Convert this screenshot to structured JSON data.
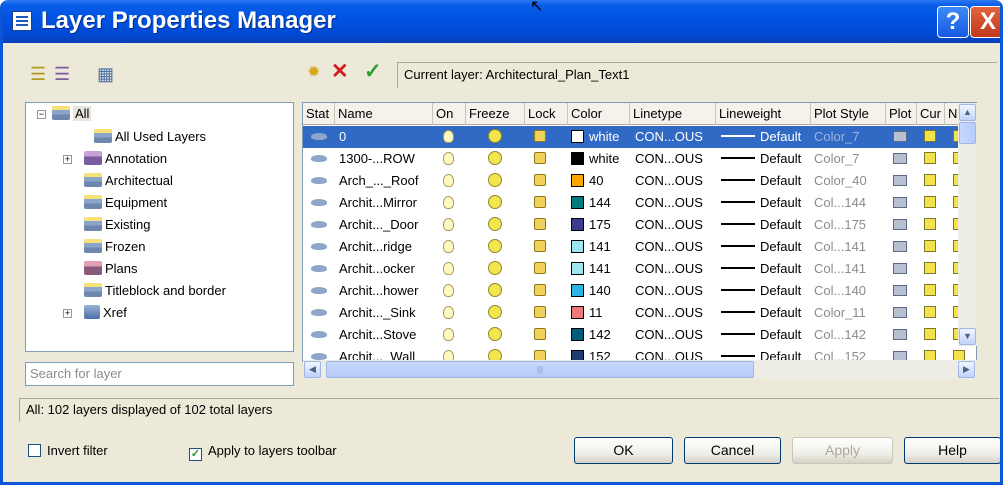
{
  "window": {
    "title": "Layer Properties Manager",
    "help_glyph": "?",
    "close_glyph": "X"
  },
  "toolbar": {
    "new_property_filter_icon": "new-property-filter-icon",
    "new_group_filter_icon": "new-group-filter-icon",
    "layer_states_icon": "layer-states-manager-icon",
    "new_layer_icon": "new-layer-icon",
    "delete_layer_icon": "delete-layer-icon",
    "set_current_icon": "set-current-icon",
    "current_layer": "Current layer: Architectural_Plan_Text1"
  },
  "tree": {
    "root": "All",
    "items": [
      {
        "label": "All Used Layers",
        "expandable": false
      },
      {
        "label": "Annotation",
        "expandable": true
      },
      {
        "label": "Architectual",
        "expandable": false
      },
      {
        "label": "Equipment",
        "expandable": false
      },
      {
        "label": "Existing",
        "expandable": false
      },
      {
        "label": "Frozen",
        "expandable": false
      },
      {
        "label": "Plans",
        "expandable": false
      },
      {
        "label": "Titleblock and border",
        "expandable": false
      },
      {
        "label": "Xref",
        "expandable": true
      }
    ]
  },
  "search": {
    "placeholder": "Search for layer"
  },
  "grid": {
    "columns": [
      "Stat",
      "Name",
      "On",
      "Freeze",
      "Lock",
      "Color",
      "Linetype",
      "Lineweight",
      "Plot Style",
      "Plot",
      "Cur",
      "Ne"
    ],
    "rows": [
      {
        "name": "0",
        "color": "white",
        "swatch": "#FFFFFF",
        "linetype": "CON...OUS",
        "lineweight": "Default",
        "plot_style": "Color_7",
        "selected": true
      },
      {
        "name": "1300-...ROW",
        "color": "white",
        "swatch": "#000000",
        "linetype": "CON...OUS",
        "lineweight": "Default",
        "plot_style": "Color_7"
      },
      {
        "name": "Arch_..._Roof",
        "color": "40",
        "swatch": "#FFA500",
        "linetype": "CON...OUS",
        "lineweight": "Default",
        "plot_style": "Color_40"
      },
      {
        "name": "Archit...Mirror",
        "color": "144",
        "swatch": "#007B7B",
        "linetype": "CON...OUS",
        "lineweight": "Default",
        "plot_style": "Col...144"
      },
      {
        "name": "Archit..._Door",
        "color": "175",
        "swatch": "#3C3C8C",
        "linetype": "CON...OUS",
        "lineweight": "Default",
        "plot_style": "Col...175"
      },
      {
        "name": "Archit...ridge",
        "color": "141",
        "swatch": "#9BE6F0",
        "linetype": "CON...OUS",
        "lineweight": "Default",
        "plot_style": "Col...141"
      },
      {
        "name": "Archit...ocker",
        "color": "141",
        "swatch": "#9BE6F0",
        "linetype": "CON...OUS",
        "lineweight": "Default",
        "plot_style": "Col...141"
      },
      {
        "name": "Archit...hower",
        "color": "140",
        "swatch": "#2DB4E6",
        "linetype": "CON...OUS",
        "lineweight": "Default",
        "plot_style": "Col...140"
      },
      {
        "name": "Archit..._Sink",
        "color": "11",
        "swatch": "#F07878",
        "linetype": "CON...OUS",
        "lineweight": "Default",
        "plot_style": "Color_11"
      },
      {
        "name": "Archit...Stove",
        "color": "142",
        "swatch": "#005A7A",
        "linetype": "CON...OUS",
        "lineweight": "Default",
        "plot_style": "Col...142"
      },
      {
        "name": "Archit..._Wall",
        "color": "152",
        "swatch": "#1E3C6E",
        "linetype": "CON...OUS",
        "lineweight": "Default",
        "plot_style": "Col...152"
      }
    ]
  },
  "status": "All: 102 layers displayed of 102 total layers",
  "options": {
    "invert_filter": {
      "label": "Invert filter",
      "checked": false
    },
    "apply_toolbar": {
      "label": "Apply to layers toolbar",
      "checked": true
    }
  },
  "buttons": {
    "ok": "OK",
    "cancel": "Cancel",
    "apply": "Apply",
    "help": "Help"
  },
  "colors": {
    "title_blue": "#0054E3",
    "selection": "#316AC5",
    "dialog_bg": "#ECE9D8"
  }
}
